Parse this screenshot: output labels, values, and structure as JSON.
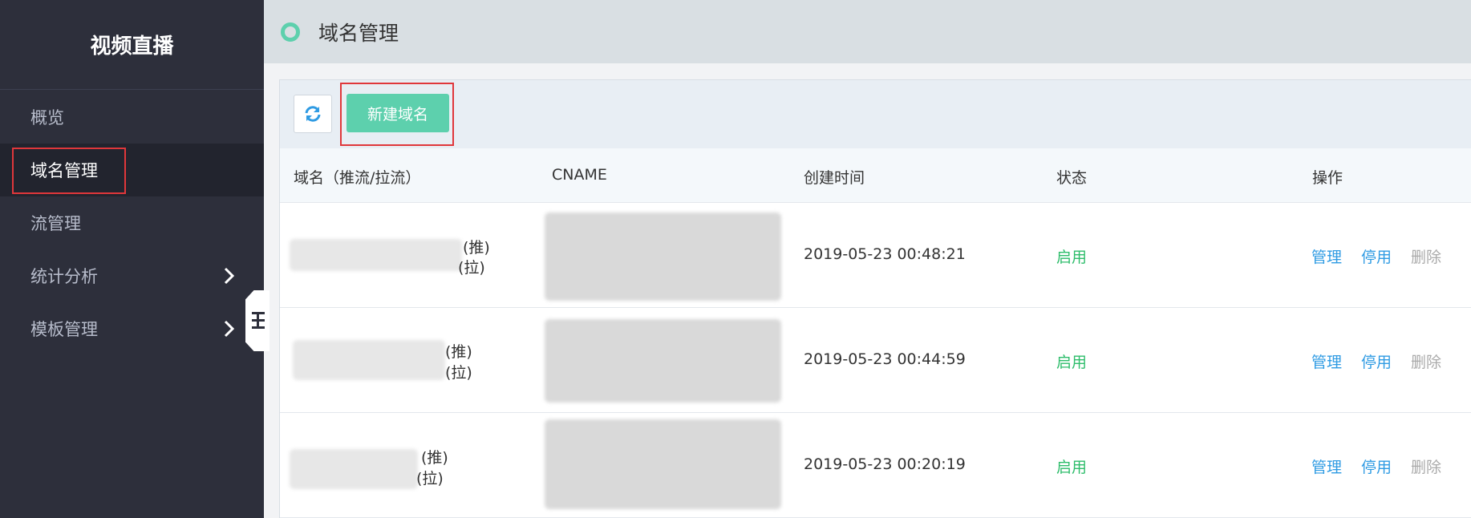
{
  "sidebar": {
    "brand": "视频直播",
    "items": [
      {
        "label": "概览",
        "active": false,
        "has_children": false
      },
      {
        "label": "域名管理",
        "active": true,
        "has_children": false
      },
      {
        "label": "流管理",
        "active": false,
        "has_children": false
      },
      {
        "label": "统计分析",
        "active": false,
        "has_children": true
      },
      {
        "label": "模板管理",
        "active": false,
        "has_children": true
      }
    ]
  },
  "header": {
    "title": "域名管理"
  },
  "toolbar": {
    "refresh_icon": "refresh-icon",
    "new_domain_label": "新建域名"
  },
  "table": {
    "columns": [
      "域名（推流/拉流）",
      "CNAME",
      "创建时间",
      "状态",
      "操作"
    ],
    "rows": [
      {
        "push_suffix": "(推)",
        "pull_suffix": "(拉)",
        "created": "2019-05-23 00:48:21",
        "status": "启用",
        "actions": [
          "管理",
          "停用",
          "删除"
        ]
      },
      {
        "push_suffix": "(推)",
        "pull_suffix": "(拉)",
        "created": "2019-05-23 00:44:59",
        "status": "启用",
        "actions": [
          "管理",
          "停用",
          "删除"
        ]
      },
      {
        "push_suffix": "(推)",
        "pull_suffix": "(拉)",
        "created": "2019-05-23 00:20:19",
        "status": "启用",
        "actions": [
          "管理",
          "停用",
          "删除"
        ]
      }
    ]
  },
  "colors": {
    "accent": "#5dd0ad",
    "sidebar_bg": "#2d2f3b",
    "link": "#2f9be3",
    "status_ok": "#2ebd6b",
    "highlight": "#e0373b"
  }
}
